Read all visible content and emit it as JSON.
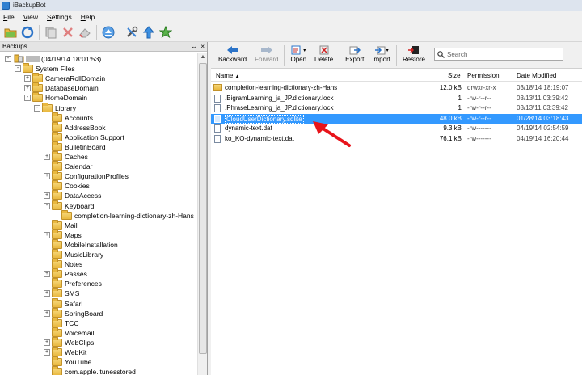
{
  "window": {
    "title": "iBackupBot"
  },
  "menu": {
    "items": [
      {
        "label": "File",
        "u": "F",
        "rest": "ile"
      },
      {
        "label": "View",
        "u": "V",
        "rest": "iew"
      },
      {
        "label": "Settings",
        "u": "S",
        "rest": "ettings"
      },
      {
        "label": "Help",
        "u": "H",
        "rest": "elp"
      }
    ]
  },
  "toolbar": {
    "icons": [
      "open-folder-icon",
      "refresh-icon",
      "copy-icon",
      "delete-icon",
      "eraser-icon",
      "eject-icon",
      "tools-icon",
      "upload-icon",
      "star-icon"
    ]
  },
  "left_panel": {
    "header": "Backups",
    "pin": "↔",
    "close": "×",
    "tree": [
      {
        "label": "(04/19/14 18:01:53)",
        "level": 0,
        "exp": "-",
        "device": true
      },
      {
        "label": "System Files",
        "level": 1,
        "exp": "-"
      },
      {
        "label": "CameraRollDomain",
        "level": 2,
        "exp": "+"
      },
      {
        "label": "DatabaseDomain",
        "level": 2,
        "exp": "+"
      },
      {
        "label": "HomeDomain",
        "level": 2,
        "exp": "-"
      },
      {
        "label": "Library",
        "level": 3,
        "exp": "-"
      },
      {
        "label": "Accounts",
        "level": 4,
        "exp": ""
      },
      {
        "label": "AddressBook",
        "level": 4,
        "exp": ""
      },
      {
        "label": "Application Support",
        "level": 4,
        "exp": ""
      },
      {
        "label": "BulletinBoard",
        "level": 4,
        "exp": ""
      },
      {
        "label": "Caches",
        "level": 4,
        "exp": "+"
      },
      {
        "label": "Calendar",
        "level": 4,
        "exp": ""
      },
      {
        "label": "ConfigurationProfiles",
        "level": 4,
        "exp": "+"
      },
      {
        "label": "Cookies",
        "level": 4,
        "exp": ""
      },
      {
        "label": "DataAccess",
        "level": 4,
        "exp": "+"
      },
      {
        "label": "Keyboard",
        "level": 4,
        "exp": "-"
      },
      {
        "label": "completion-learning-dictionary-zh-Hans",
        "level": 5,
        "exp": ""
      },
      {
        "label": "Mail",
        "level": 4,
        "exp": ""
      },
      {
        "label": "Maps",
        "level": 4,
        "exp": "+"
      },
      {
        "label": "MobileInstallation",
        "level": 4,
        "exp": ""
      },
      {
        "label": "MusicLibrary",
        "level": 4,
        "exp": ""
      },
      {
        "label": "Notes",
        "level": 4,
        "exp": ""
      },
      {
        "label": "Passes",
        "level": 4,
        "exp": "+"
      },
      {
        "label": "Preferences",
        "level": 4,
        "exp": ""
      },
      {
        "label": "SMS",
        "level": 4,
        "exp": "+"
      },
      {
        "label": "Safari",
        "level": 4,
        "exp": ""
      },
      {
        "label": "SpringBoard",
        "level": 4,
        "exp": "+"
      },
      {
        "label": "TCC",
        "level": 4,
        "exp": ""
      },
      {
        "label": "Voicemail",
        "level": 4,
        "exp": ""
      },
      {
        "label": "WebClips",
        "level": 4,
        "exp": "+"
      },
      {
        "label": "WebKit",
        "level": 4,
        "exp": "+"
      },
      {
        "label": "YouTube",
        "level": 4,
        "exp": ""
      },
      {
        "label": "com.apple.itunesstored",
        "level": 4,
        "exp": ""
      }
    ]
  },
  "right_toolbar": {
    "backward": "Backward",
    "forward": "Forward",
    "open": "Open",
    "delete": "Delete",
    "export": "Export",
    "import": "Import",
    "restore": "Restore",
    "search_placeholder": "Search"
  },
  "file_list": {
    "columns": {
      "name": "Name",
      "size": "Size",
      "permission": "Permission",
      "date": "Date Modified"
    },
    "rows": [
      {
        "name": "completion-learning-dictionary-zh-Hans",
        "size": "12.0 kB",
        "permission": "drwxr-xr-x",
        "date": "03/18/14 18:19:07",
        "folder": true,
        "selected": false
      },
      {
        "name": ".BigramLearning_ja_JP.dictionary.lock",
        "size": "1",
        "permission": "-rw-r--r--",
        "date": "03/13/11 03:39:42",
        "folder": false,
        "selected": false
      },
      {
        "name": ".PhraseLearning_ja_JP.dictionary.lock",
        "size": "1",
        "permission": "-rw-r--r--",
        "date": "03/13/11 03:39:42",
        "folder": false,
        "selected": false
      },
      {
        "name": "CloudUserDictionary.sqlite",
        "size": "48.0 kB",
        "permission": "-rw-r--r--",
        "date": "01/28/14 03:18:43",
        "folder": false,
        "selected": true
      },
      {
        "name": "dynamic-text.dat",
        "size": "9.3 kB",
        "permission": "-rw-------",
        "date": "04/19/14 02:54:59",
        "folder": false,
        "selected": false
      },
      {
        "name": "ko_KO-dynamic-text.dat",
        "size": "76.1 kB",
        "permission": "-rw-------",
        "date": "04/19/14 16:20:44",
        "folder": false,
        "selected": false
      }
    ]
  },
  "colors": {
    "selection": "#3399ff",
    "arrow": "#e8141b",
    "folder": "#e9b83f"
  }
}
